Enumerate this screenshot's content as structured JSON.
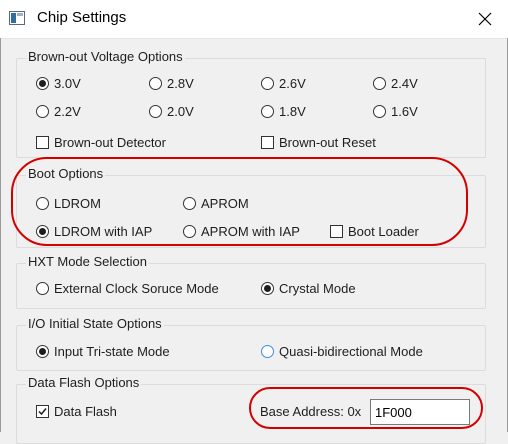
{
  "window": {
    "title": "Chip Settings",
    "close_icon": "close-icon"
  },
  "brownout": {
    "legend": "Brown-out Voltage Options",
    "voltages": [
      "3.0V",
      "2.8V",
      "2.6V",
      "2.4V",
      "2.2V",
      "2.0V",
      "1.8V",
      "1.6V"
    ],
    "selected": "3.0V",
    "detector_label": "Brown-out Detector",
    "detector_checked": false,
    "reset_label": "Brown-out Reset",
    "reset_checked": false
  },
  "boot": {
    "legend": "Boot Options",
    "ldrom": "LDROM",
    "aprom": "APROM",
    "ldrom_iap": "LDROM with IAP",
    "aprom_iap": "APROM with IAP",
    "selected": "LDROM with IAP",
    "boot_loader": "Boot Loader",
    "boot_loader_checked": false
  },
  "hxt": {
    "legend": "HXT Mode Selection",
    "external": "External Clock Soruce Mode",
    "crystal": "Crystal Mode",
    "selected": "Crystal Mode"
  },
  "io": {
    "legend": "I/O Initial State Options",
    "tristate": "Input Tri-state Mode",
    "quasi": "Quasi-bidirectional Mode",
    "selected": "Input Tri-state Mode"
  },
  "dataflash": {
    "legend": "Data Flash Options",
    "enable_label": "Data Flash",
    "enable_checked": true,
    "base_label": "Base Address: 0x",
    "base_value": "1F000"
  },
  "annotation_color": "#d40000"
}
